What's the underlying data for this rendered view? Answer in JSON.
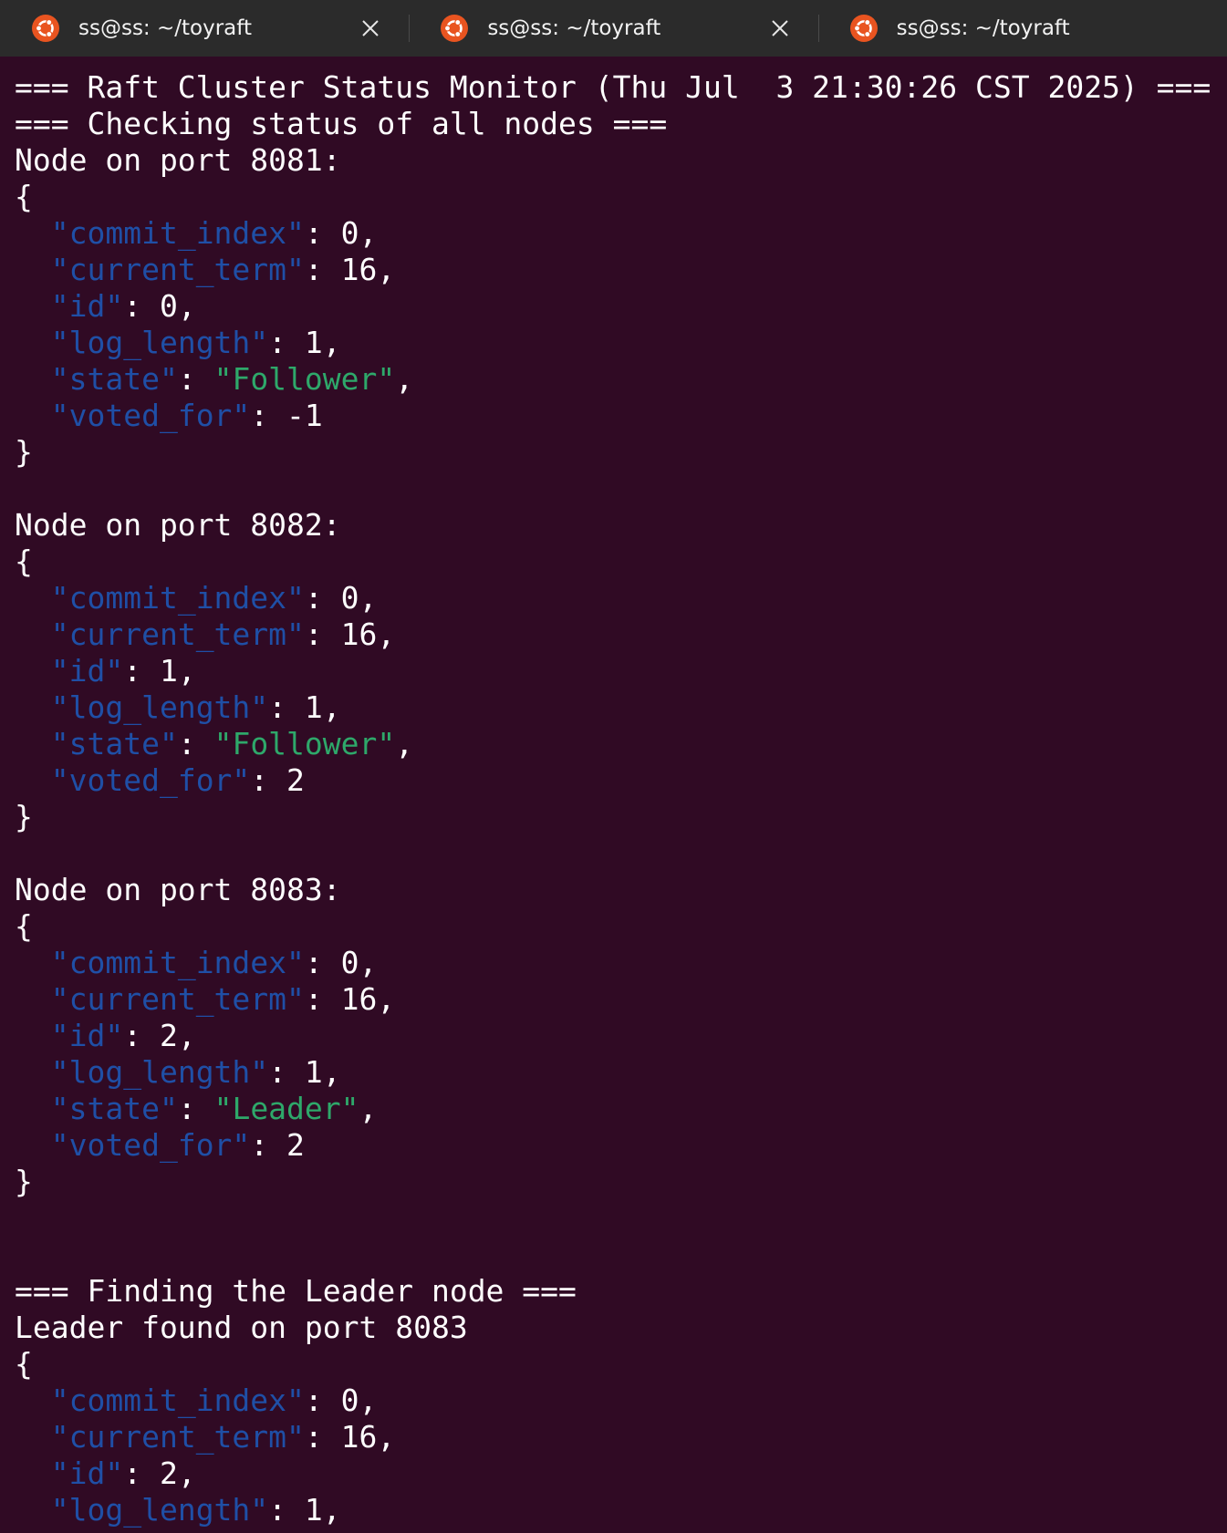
{
  "tabs": [
    {
      "title": "ss@ss: ~/toyraft",
      "icon": "ubuntu-icon",
      "closable": true
    },
    {
      "title": "ss@ss: ~/toyraft",
      "icon": "ubuntu-icon",
      "closable": true
    },
    {
      "title": "ss@ss: ~/toyraft",
      "icon": "ubuntu-icon",
      "closable": false
    }
  ],
  "colors": {
    "background": "#300a24",
    "tabbar": "#2b2b2b",
    "text": "#ffffff",
    "json_key": "#1f4fa6",
    "json_string": "#2ea86a",
    "ubuntu_orange": "#e95420"
  },
  "terminal": {
    "lines": [
      {
        "text": "=== Raft Cluster Status Monitor (Thu Jul  3 21:30:26 CST 2025) ==="
      },
      {
        "text": "=== Checking status of all nodes ==="
      },
      {
        "text": "Node on port 8081:"
      },
      {
        "text": "{"
      },
      {
        "indent": "  ",
        "key": "\"commit_index\"",
        "sep": ": ",
        "value": "0",
        "value_type": "number",
        "trail": ","
      },
      {
        "indent": "  ",
        "key": "\"current_term\"",
        "sep": ": ",
        "value": "16",
        "value_type": "number",
        "trail": ","
      },
      {
        "indent": "  ",
        "key": "\"id\"",
        "sep": ": ",
        "value": "0",
        "value_type": "number",
        "trail": ","
      },
      {
        "indent": "  ",
        "key": "\"log_length\"",
        "sep": ": ",
        "value": "1",
        "value_type": "number",
        "trail": ","
      },
      {
        "indent": "  ",
        "key": "\"state\"",
        "sep": ": ",
        "value": "\"Follower\"",
        "value_type": "string",
        "trail": ","
      },
      {
        "indent": "  ",
        "key": "\"voted_for\"",
        "sep": ": ",
        "value": "-1",
        "value_type": "number",
        "trail": ""
      },
      {
        "text": "}"
      },
      {
        "text": ""
      },
      {
        "text": "Node on port 8082:"
      },
      {
        "text": "{"
      },
      {
        "indent": "  ",
        "key": "\"commit_index\"",
        "sep": ": ",
        "value": "0",
        "value_type": "number",
        "trail": ","
      },
      {
        "indent": "  ",
        "key": "\"current_term\"",
        "sep": ": ",
        "value": "16",
        "value_type": "number",
        "trail": ","
      },
      {
        "indent": "  ",
        "key": "\"id\"",
        "sep": ": ",
        "value": "1",
        "value_type": "number",
        "trail": ","
      },
      {
        "indent": "  ",
        "key": "\"log_length\"",
        "sep": ": ",
        "value": "1",
        "value_type": "number",
        "trail": ","
      },
      {
        "indent": "  ",
        "key": "\"state\"",
        "sep": ": ",
        "value": "\"Follower\"",
        "value_type": "string",
        "trail": ","
      },
      {
        "indent": "  ",
        "key": "\"voted_for\"",
        "sep": ": ",
        "value": "2",
        "value_type": "number",
        "trail": ""
      },
      {
        "text": "}"
      },
      {
        "text": ""
      },
      {
        "text": "Node on port 8083:"
      },
      {
        "text": "{"
      },
      {
        "indent": "  ",
        "key": "\"commit_index\"",
        "sep": ": ",
        "value": "0",
        "value_type": "number",
        "trail": ","
      },
      {
        "indent": "  ",
        "key": "\"current_term\"",
        "sep": ": ",
        "value": "16",
        "value_type": "number",
        "trail": ","
      },
      {
        "indent": "  ",
        "key": "\"id\"",
        "sep": ": ",
        "value": "2",
        "value_type": "number",
        "trail": ","
      },
      {
        "indent": "  ",
        "key": "\"log_length\"",
        "sep": ": ",
        "value": "1",
        "value_type": "number",
        "trail": ","
      },
      {
        "indent": "  ",
        "key": "\"state\"",
        "sep": ": ",
        "value": "\"Leader\"",
        "value_type": "string",
        "trail": ","
      },
      {
        "indent": "  ",
        "key": "\"voted_for\"",
        "sep": ": ",
        "value": "2",
        "value_type": "number",
        "trail": ""
      },
      {
        "text": "}"
      },
      {
        "text": ""
      },
      {
        "text": ""
      },
      {
        "text": "=== Finding the Leader node ==="
      },
      {
        "text": "Leader found on port 8083"
      },
      {
        "text": "{"
      },
      {
        "indent": "  ",
        "key": "\"commit_index\"",
        "sep": ": ",
        "value": "0",
        "value_type": "number",
        "trail": ","
      },
      {
        "indent": "  ",
        "key": "\"current_term\"",
        "sep": ": ",
        "value": "16",
        "value_type": "number",
        "trail": ","
      },
      {
        "indent": "  ",
        "key": "\"id\"",
        "sep": ": ",
        "value": "2",
        "value_type": "number",
        "trail": ","
      },
      {
        "indent": "  ",
        "key": "\"log_length\"",
        "sep": ": ",
        "value": "1",
        "value_type": "number",
        "trail": ","
      }
    ]
  }
}
